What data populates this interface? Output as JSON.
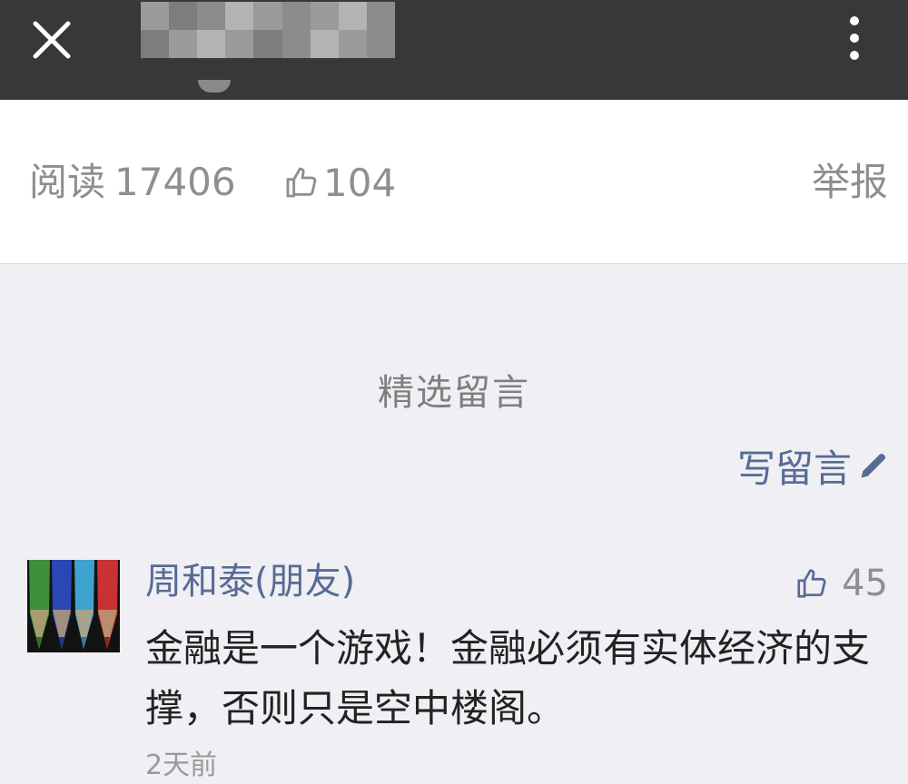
{
  "header": {
    "close_icon": "close-icon",
    "title": "",
    "more_icon": "more-vertical-icon"
  },
  "stats": {
    "read_label": "阅读",
    "read_count": "17406",
    "like_icon": "thumbs-up-icon",
    "like_count": "104",
    "report_label": "举报"
  },
  "comments_section": {
    "title": "精选留言",
    "write_label": "写留言",
    "write_icon": "pencil-icon"
  },
  "comments": [
    {
      "avatar": "colored-pencils-avatar",
      "nickname": "周和泰(朋友)",
      "like_count": "45",
      "text": "金融是一个游戏！金融必须有实体经济的支撑，否则只是空中楼阁。",
      "time": "2天前"
    }
  ],
  "colors": {
    "topbar": "#383838",
    "link": "#576b95",
    "muted": "#8e8e93",
    "background": "#efeff4"
  }
}
